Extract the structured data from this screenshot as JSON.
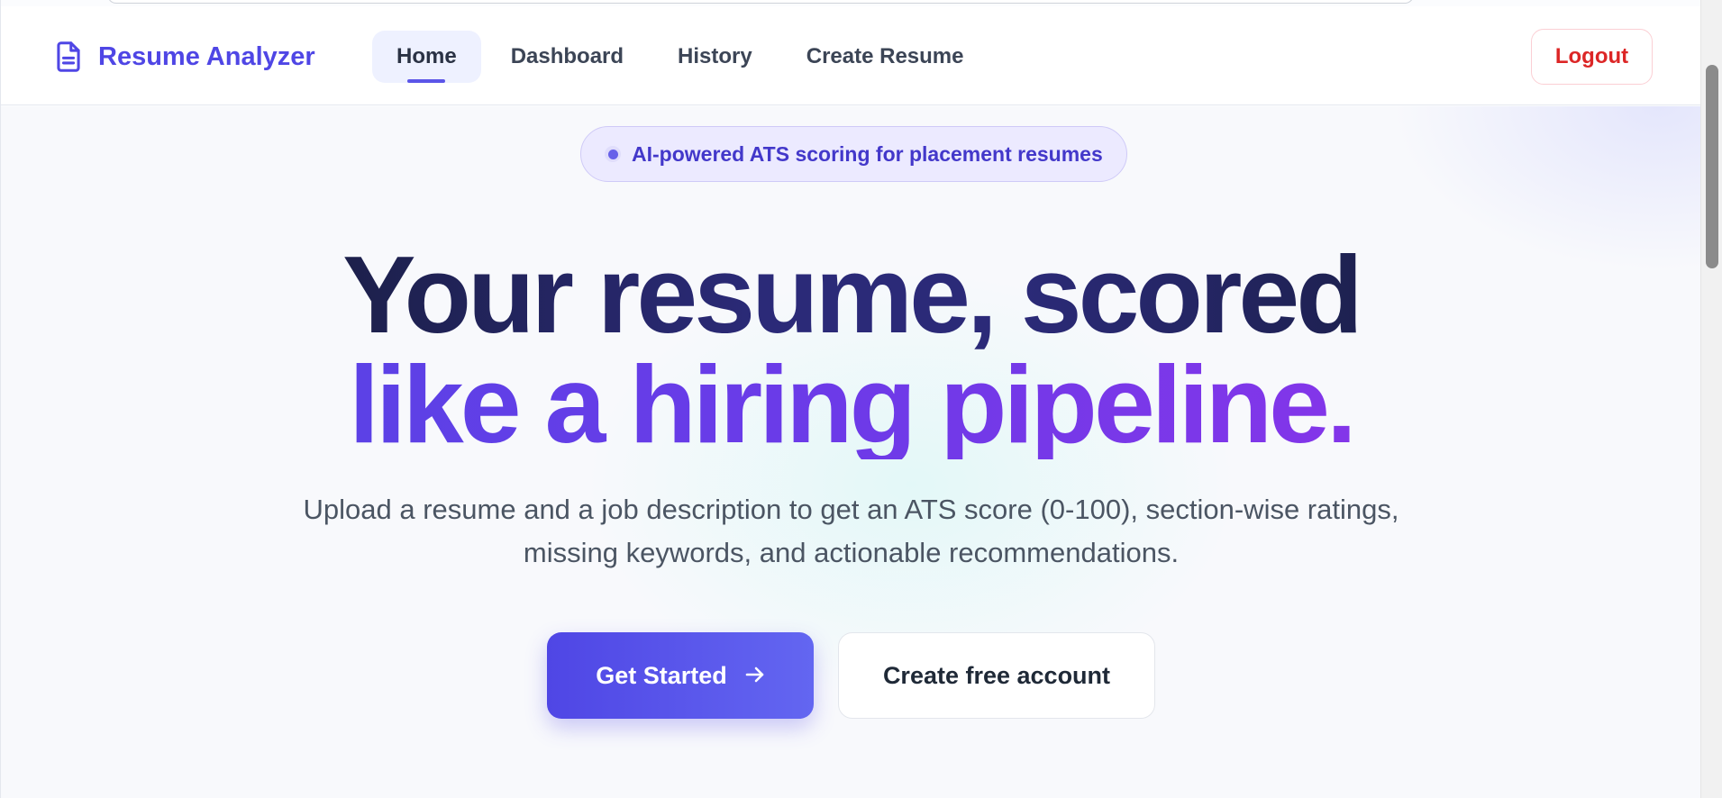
{
  "brand": {
    "name": "Resume Analyzer",
    "icon": "document-icon",
    "color": "#4f46e5"
  },
  "nav": {
    "items": [
      {
        "label": "Home",
        "active": true
      },
      {
        "label": "Dashboard",
        "active": false
      },
      {
        "label": "History",
        "active": false
      },
      {
        "label": "Create Resume",
        "active": false
      }
    ],
    "logout_label": "Logout"
  },
  "hero": {
    "badge": "AI-powered ATS scoring for placement resumes",
    "headline_line1": "Your resume, scored",
    "headline_line2": "like a hiring pipeline.",
    "subtitle": "Upload a resume and a job description to get an ATS score (0-100), section-wise ratings, missing keywords, and actionable recommendations.",
    "primary_cta": "Get Started",
    "primary_cta_icon": "arrow-right-icon",
    "secondary_cta": "Create free account"
  },
  "colors": {
    "accent": "#4f46e5",
    "accent_purple": "#9333ea",
    "danger": "#dc2626",
    "headline_dark": "#111827"
  }
}
